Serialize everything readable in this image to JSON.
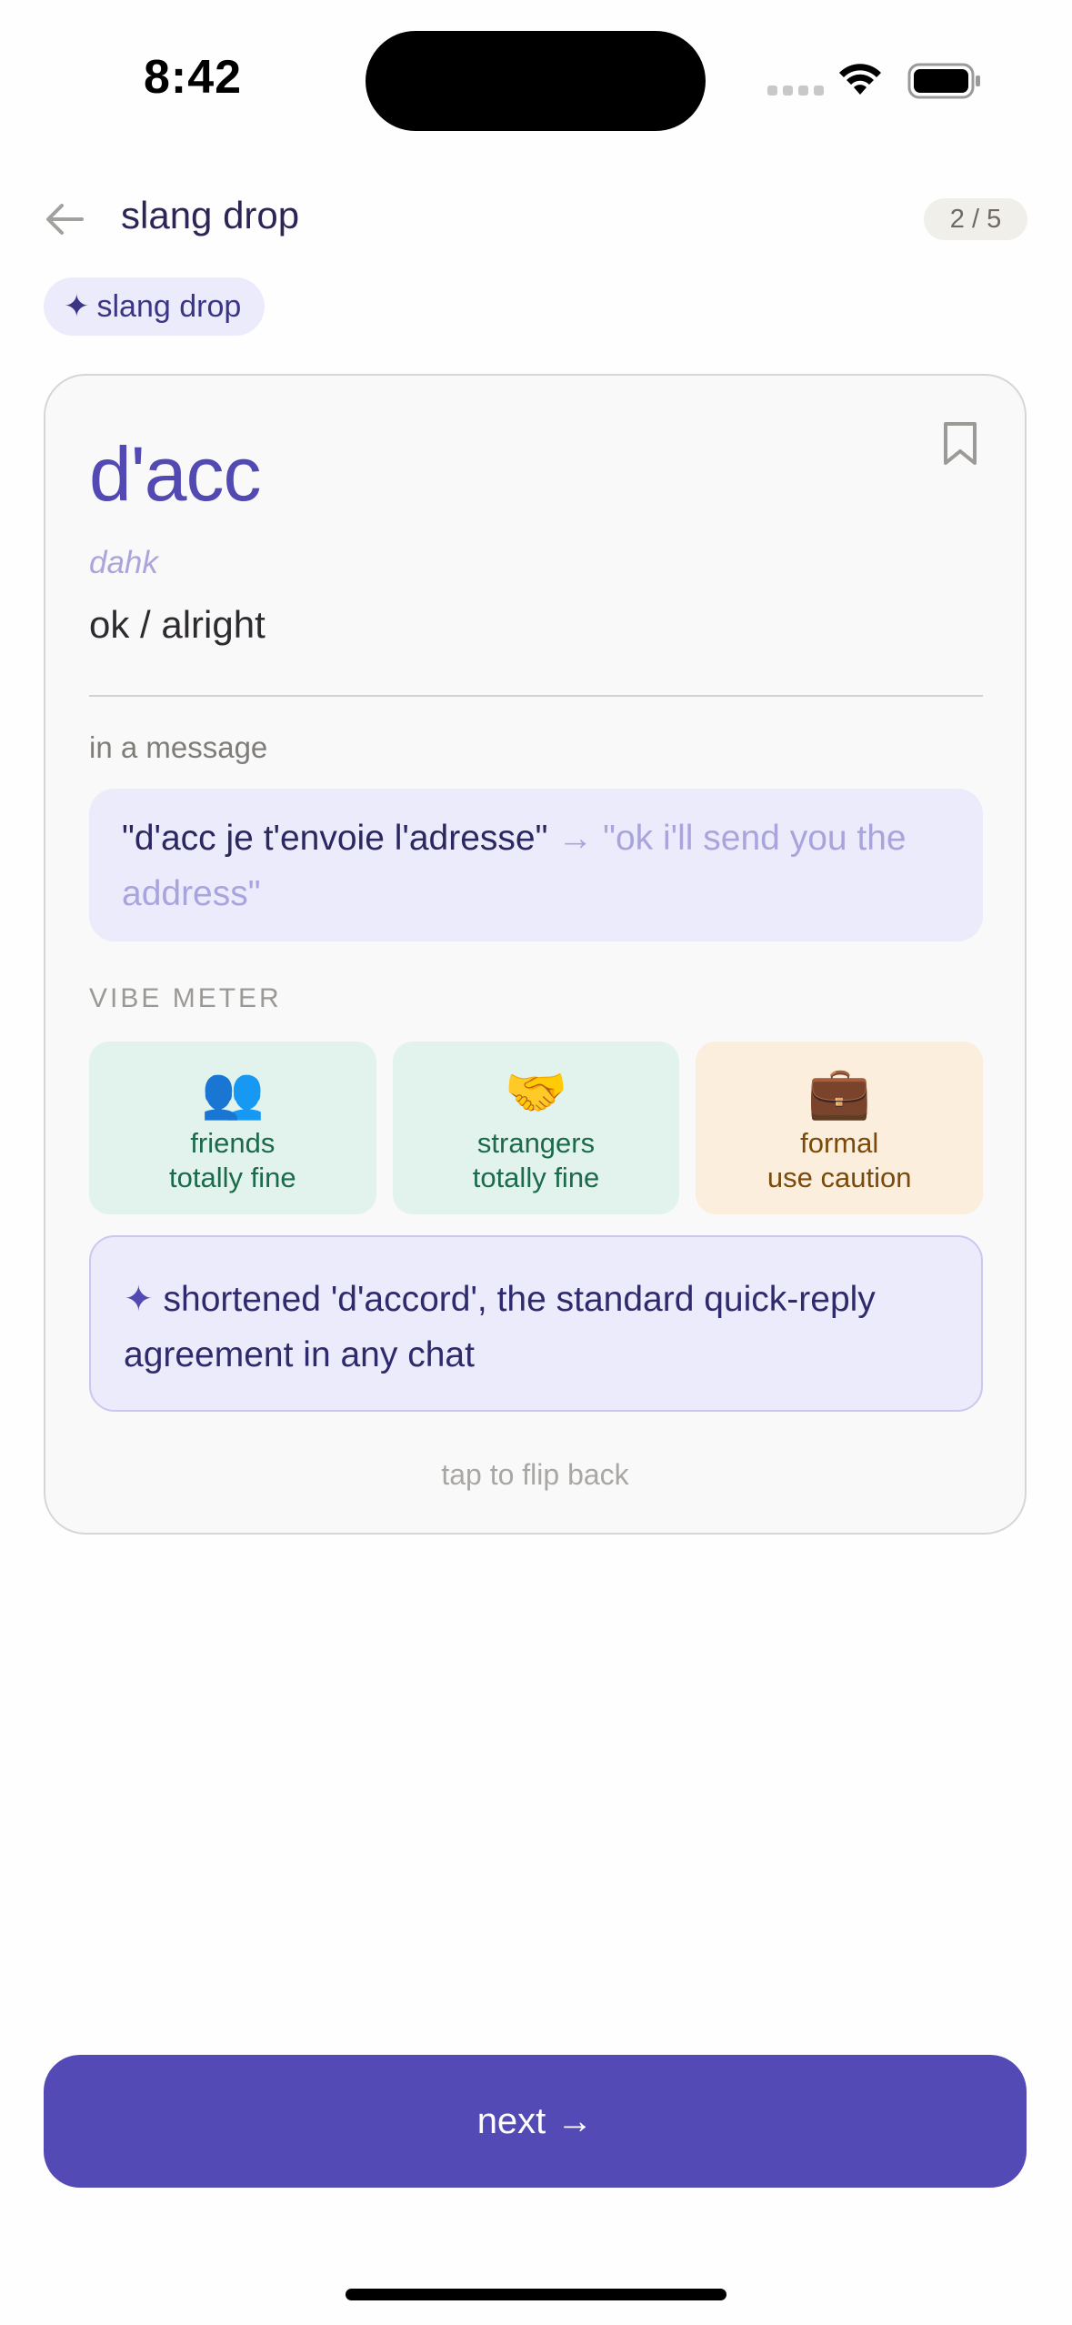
{
  "status_bar": {
    "time": "8:42"
  },
  "header": {
    "title": "slang drop",
    "progress": "2 / 5"
  },
  "category_chip": {
    "icon": "✦",
    "label": "slang drop"
  },
  "card": {
    "word": "d'acc",
    "pronunciation": "dahk",
    "meaning": "ok / alright",
    "example_label": "in a message",
    "example": {
      "french": "\"d'acc je t'envoie l'adresse\"",
      "arrow": "→",
      "english": "\"ok i'll send you the address\""
    },
    "vibe_label": "VIBE METER",
    "vibe": [
      {
        "emoji": "👥",
        "audience": "friends",
        "level": "totally fine",
        "status": "ok"
      },
      {
        "emoji": "🤝",
        "audience": "strangers",
        "level": "totally fine",
        "status": "ok"
      },
      {
        "emoji": "💼",
        "audience": "formal",
        "level": "use caution",
        "status": "caution"
      }
    ],
    "note": {
      "icon": "✦",
      "text": "shortened 'd'accord', the standard quick-reply agreement in any chat"
    },
    "flip_hint": "tap to flip back"
  },
  "next_button": {
    "label": "next",
    "arrow": "→"
  },
  "colors": {
    "accent": "#534ab6",
    "chip_bg": "#ecebfb",
    "ok_bg": "#e1f3ec",
    "caution_bg": "#fbeedc"
  }
}
